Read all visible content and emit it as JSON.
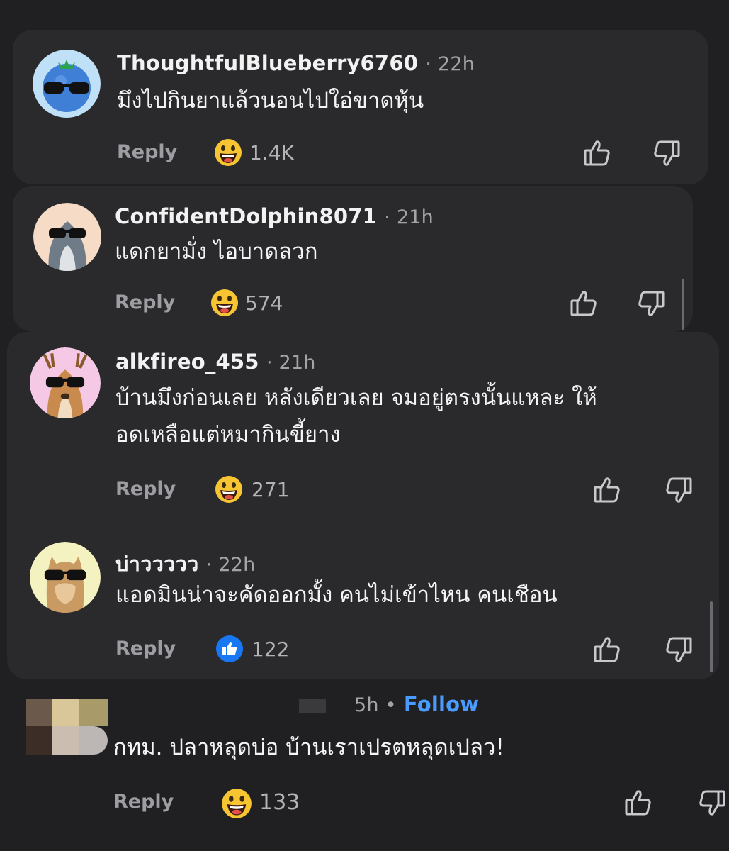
{
  "comments": [
    {
      "username": "ThoughtfulBlueberry6760",
      "time": "· 22h",
      "text": "มึงไปกินยาแล้วนอนไปใอ่ขาดหุ้น",
      "reply_label": "Reply",
      "reaction_icon": "laughing-face-icon",
      "reaction_count": "1.4K"
    },
    {
      "username": "ConfidentDolphin8071",
      "time": "· 21h",
      "text": "แดกยามั่ง ไอบาดลวก",
      "reply_label": "Reply",
      "reaction_icon": "laughing-face-icon",
      "reaction_count": "574"
    },
    {
      "username": "alkfireo_455",
      "time": "· 21h",
      "text_line1": "บ้านมึงก่อนเลย หลังเดียวเลย จมอยู่ตรงนั้นแหละ ให้",
      "text_line2": "อดเหลือแต่หมากินขี้ยาง",
      "reply_label": "Reply",
      "reaction_icon": "laughing-face-icon",
      "reaction_count": "271"
    },
    {
      "username": "บ่าววววว",
      "time": "· 22h",
      "text": "แอดมินน่าจะคัดออกมั้ง คนไม่เข้าไหน คนเชือน",
      "reply_label": "Reply",
      "reaction_icon": "like-icon",
      "reaction_count": "122"
    },
    {
      "time": "5h •",
      "follow_label": "Follow",
      "text": "กทม. ปลาหลุดบ่อ บ้านเราเปรตหลุดเปลว!",
      "reply_label": "Reply",
      "reaction_icon": "laughing-face-icon",
      "reaction_count": "133"
    }
  ],
  "colors": {
    "background": "#202022",
    "card": "#2a2a2d",
    "follow": "#4a9bff",
    "like_blue": "#1877f2",
    "laugh_yellow": "#f7c531"
  }
}
